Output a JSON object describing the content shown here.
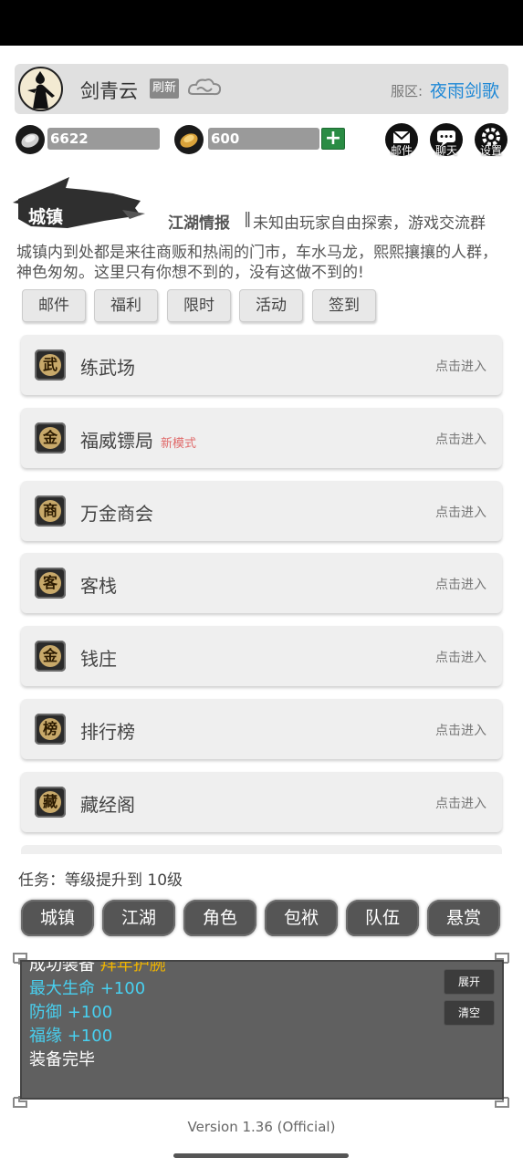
{
  "player": {
    "name": "剑青云",
    "refresh_label": "刷新",
    "server_label": "服区:",
    "server_name": "夜雨剑歌"
  },
  "currency": {
    "silver": "6622",
    "gold": "600",
    "plus": "+"
  },
  "top_icons": [
    {
      "label": "邮件"
    },
    {
      "label": "聊天"
    },
    {
      "label": "设置"
    }
  ],
  "location": {
    "title": "城镇",
    "news_label": "江湖情报",
    "news_separator": "‖",
    "news_text": "未知由玩家自由探索，游戏交流群",
    "description": "城镇内到处都是来往商贩和热闹的门市，车水马龙，熙熙攘攘的人群，神色匆匆。这里只有你想不到的，没有这做不到的!"
  },
  "tabs": [
    "邮件",
    "福利",
    "限时",
    "活动",
    "签到"
  ],
  "places": [
    {
      "icon": "武",
      "name": "练武场",
      "badge": "",
      "action": "点击进入"
    },
    {
      "icon": "金",
      "name": "福威镖局",
      "badge": "新模式",
      "action": "点击进入"
    },
    {
      "icon": "商",
      "name": "万金商会",
      "badge": "",
      "action": "点击进入"
    },
    {
      "icon": "客",
      "name": "客栈",
      "badge": "",
      "action": "点击进入"
    },
    {
      "icon": "金",
      "name": "钱庄",
      "badge": "",
      "action": "点击进入"
    },
    {
      "icon": "榜",
      "name": "排行榜",
      "badge": "",
      "action": "点击进入"
    },
    {
      "icon": "藏",
      "name": "藏经阁",
      "badge": "",
      "action": "点击进入"
    }
  ],
  "task": "任务：等级提升到 10级",
  "nav": [
    "城镇",
    "江湖",
    "角色",
    "包袱",
    "队伍",
    "悬赏"
  ],
  "log": {
    "lines": [
      {
        "text": "成功装备 ",
        "extra": "拜年护腕",
        "color": "#ffffff",
        "extra_color": "#f0b400"
      },
      {
        "text": "最大生命 +100",
        "extra": "",
        "color": "#48d0f0",
        "extra_color": ""
      },
      {
        "text": "防御 +100",
        "extra": "",
        "color": "#48d0f0",
        "extra_color": ""
      },
      {
        "text": "福缘 +100",
        "extra": "",
        "color": "#48d0f0",
        "extra_color": ""
      },
      {
        "text": "装备完毕",
        "extra": "",
        "color": "#ffffff",
        "extra_color": ""
      }
    ],
    "expand_label": "展开",
    "clear_label": "清空"
  },
  "version": "Version 1.36 (Official)"
}
